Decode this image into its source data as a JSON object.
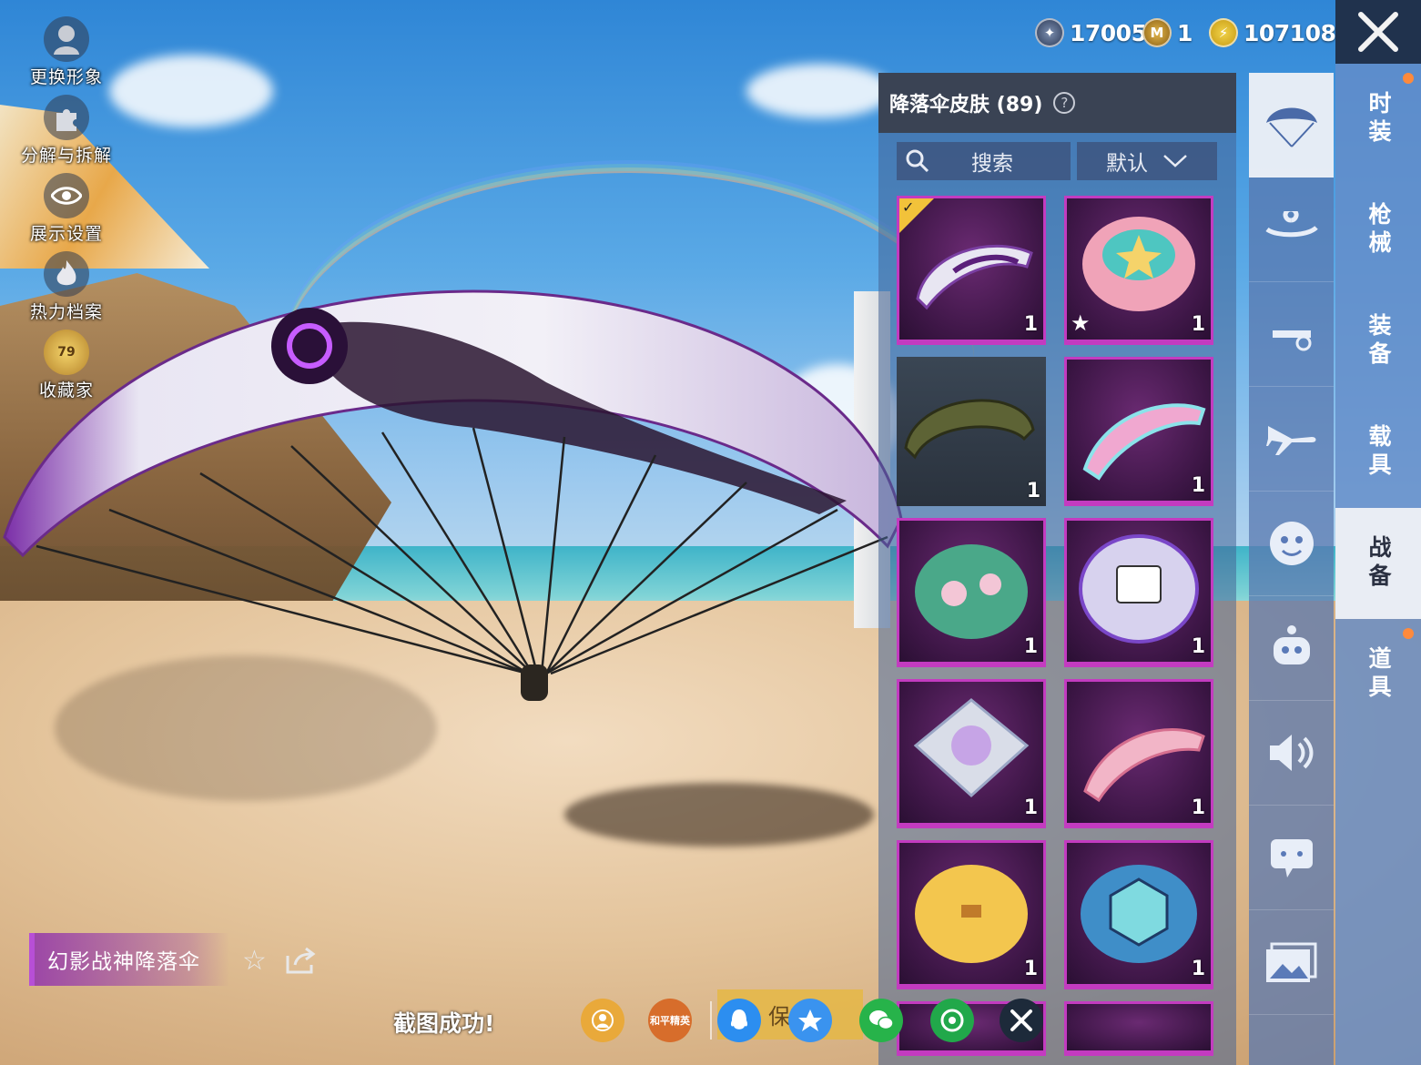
{
  "left_menu": [
    {
      "label": "更换形象",
      "icon": "avatar-icon"
    },
    {
      "label": "分解与拆解",
      "icon": "puzzle-icon"
    },
    {
      "label": "展示设置",
      "icon": "eye-icon"
    },
    {
      "label": "热力档案",
      "icon": "flame-icon"
    },
    {
      "label": "收藏家",
      "icon": "collector-badge-icon",
      "badge": "79"
    }
  ],
  "currency": [
    {
      "icon": "uc-coin-icon",
      "value": "17005"
    },
    {
      "icon": "m-coin-icon",
      "value": "1"
    },
    {
      "icon": "bp-coin-icon",
      "value": "107108"
    }
  ],
  "panel": {
    "title": "降落伞皮肤 (89)",
    "help": "?",
    "search_label": "搜索",
    "sort_label": "默认"
  },
  "items": [
    {
      "qty": "1",
      "equipped": true,
      "style": "rare"
    },
    {
      "qty": "1",
      "favorite": true,
      "style": "rare"
    },
    {
      "qty": "1",
      "style": "plain"
    },
    {
      "qty": "1",
      "style": "rare"
    },
    {
      "qty": "1",
      "style": "rare"
    },
    {
      "qty": "1",
      "style": "rare"
    },
    {
      "qty": "1",
      "style": "rare"
    },
    {
      "qty": "1",
      "style": "rare"
    },
    {
      "qty": "1",
      "style": "rare"
    },
    {
      "qty": "1",
      "style": "rare"
    },
    {
      "qty": "",
      "style": "rare"
    },
    {
      "qty": "",
      "style": "rare"
    }
  ],
  "rail_icons": [
    "parachute-icon",
    "skydive-icon",
    "drone-icon",
    "plane-icon",
    "emote-icon",
    "robot-icon",
    "sound-icon",
    "chat-bubble-icon",
    "photo-icon"
  ],
  "categories": [
    {
      "label": "时装",
      "dot": true
    },
    {
      "label": "枪械",
      "dot": false
    },
    {
      "label": "装备",
      "dot": false
    },
    {
      "label": "载具",
      "dot": false
    },
    {
      "label": "战备",
      "dot": false,
      "active": true
    },
    {
      "label": "道具",
      "dot": true
    }
  ],
  "selected_item_name": "幻影战神降落伞",
  "toast": "截图成功!",
  "save_label": "保存",
  "share": [
    {
      "icon": "profile-share-icon",
      "color": "#e9a93a"
    },
    {
      "icon": "game-partner-icon",
      "color": "#d76d2b",
      "text": "和平精英"
    },
    {
      "icon": "qq-icon",
      "color": "#2c8ef0"
    },
    {
      "icon": "qzone-icon",
      "color": "#3a93ef"
    },
    {
      "icon": "wechat-icon",
      "color": "#27b34a"
    },
    {
      "icon": "moments-icon",
      "color": "#21a84a"
    },
    {
      "icon": "close-share-icon",
      "color": "#1d2a3a"
    }
  ],
  "colors": {
    "rare_border": "#c33bc0",
    "gold": "#f2c23a",
    "panel_header": "#3a4354"
  }
}
